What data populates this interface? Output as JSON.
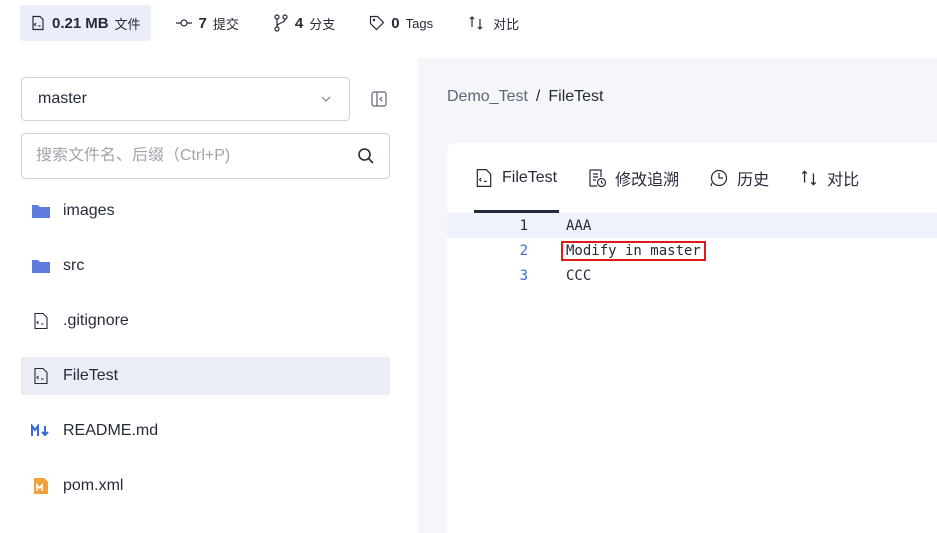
{
  "stats": {
    "files": {
      "value": "0.21",
      "unit": "MB",
      "label": "文件"
    },
    "commits": {
      "value": "7",
      "label": "提交"
    },
    "branches": {
      "value": "4",
      "label": "分支"
    },
    "tags": {
      "value": "0",
      "label": "Tags"
    },
    "compare": {
      "label": "对比"
    }
  },
  "sidebar": {
    "branch": "master",
    "search_placeholder": "搜索文件名、后缀（Ctrl+P)",
    "items": [
      {
        "label": "images",
        "icon": "folder-icon"
      },
      {
        "label": "src",
        "icon": "folder-icon"
      },
      {
        "label": ".gitignore",
        "icon": "file-code-icon"
      },
      {
        "label": "FileTest",
        "icon": "file-code-icon"
      },
      {
        "label": "README.md",
        "icon": "markdown-icon"
      },
      {
        "label": "pom.xml",
        "icon": "maven-icon"
      }
    ]
  },
  "breadcrumb": {
    "root": "Demo_Test",
    "separator": "/",
    "current": "FileTest"
  },
  "tabs": [
    {
      "label": "FileTest",
      "icon": "file-code-icon"
    },
    {
      "label": "修改追溯",
      "icon": "blame-icon"
    },
    {
      "label": "历史",
      "icon": "history-icon"
    },
    {
      "label": "对比",
      "icon": "compare-icon"
    }
  ],
  "code": [
    {
      "num": "1",
      "text": "AAA"
    },
    {
      "num": "2",
      "text": "Modify in master"
    },
    {
      "num": "3",
      "text": "CCC"
    }
  ],
  "colors": {
    "accent": "#3b69d6",
    "highlight_box": "#e01a1a",
    "folder": "#5e7ce0"
  }
}
